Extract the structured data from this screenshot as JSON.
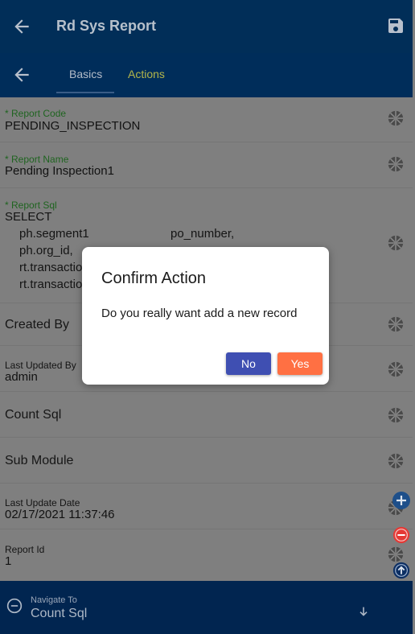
{
  "app": {
    "title": "Rd Sys Report"
  },
  "tabs": [
    {
      "label": "Basics",
      "active": true
    },
    {
      "label": "Actions",
      "active": false
    }
  ],
  "fields": {
    "report_code": {
      "label": "* Report Code",
      "value": "PENDING_INSPECTION"
    },
    "report_name": {
      "label": "* Report Name",
      "value": "Pending Inspection1"
    },
    "report_sql": {
      "label": "* Report Sql",
      "line1": "SELECT",
      "line2a": "ph.segment1",
      "line2b": "po_number,",
      "line3": "ph.org_id,",
      "line4": "rt.transactio",
      "line5": "rt.transactio"
    },
    "created_by": {
      "label": "Created By"
    },
    "last_updated_by": {
      "label": "Last Updated By",
      "value": "admin"
    },
    "count_sql": {
      "label": "Count Sql"
    },
    "sub_module": {
      "label": "Sub Module"
    },
    "last_update_date": {
      "label": "Last Update Date",
      "value": "02/17/2021 11:37:46"
    },
    "report_id": {
      "label": "Report Id",
      "value": "1"
    }
  },
  "dialog": {
    "title": "Confirm Action",
    "message": "Do you really want add a new record",
    "no_label": "No",
    "yes_label": "Yes"
  },
  "bottom_nav": {
    "label": "Navigate To",
    "value": "Count Sql"
  },
  "colors": {
    "header": "#012e58",
    "accent_tab": "#b3b54a",
    "required_label": "#1f6420",
    "no_button": "#3f4fb2",
    "yes_button": "#ff7043",
    "fab_add": "#1e4f8a",
    "fab_remove": "#e53935"
  },
  "icons": {
    "back": "arrow-left-icon",
    "save": "floppy-disk-icon",
    "field_action": "aperture-icon",
    "add": "plus-circle-icon",
    "remove": "minus-circle-icon",
    "up": "arrow-up-circle-icon",
    "nav_collapse": "minus-circle-outline-icon",
    "nav_down": "arrow-down-icon"
  }
}
